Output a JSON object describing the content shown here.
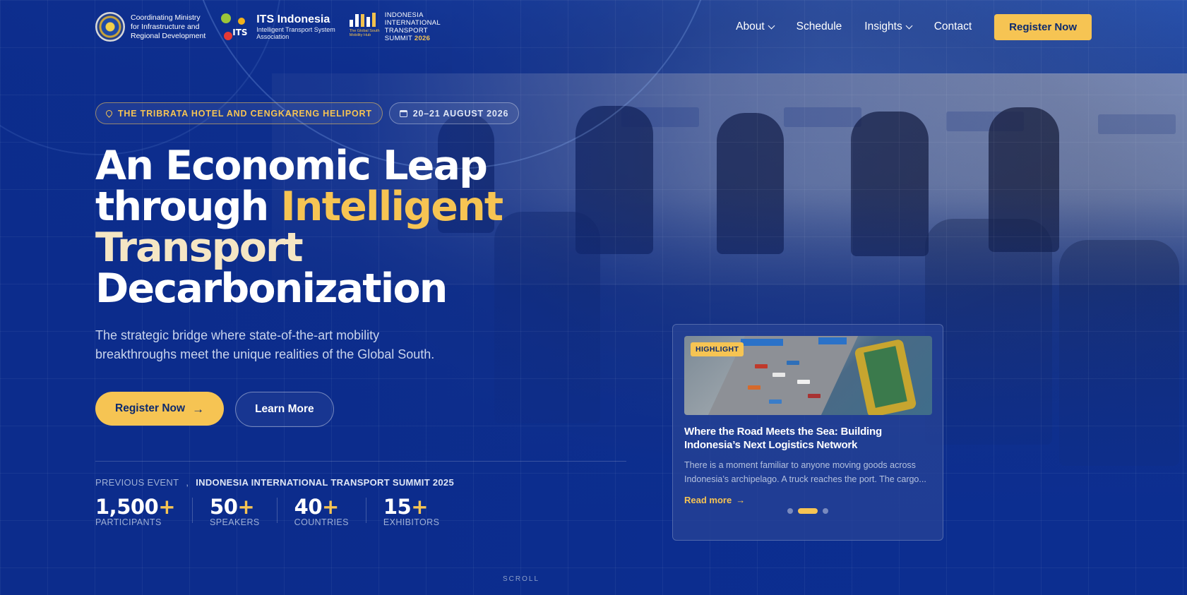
{
  "header": {
    "ministry": [
      "Coordinating Ministry",
      "for Infrastructure and",
      "Regional Development"
    ],
    "its": {
      "name": "ITS Indonesia",
      "subtitle1": "Intelligent Transport System",
      "subtitle2": "Association",
      "mark": "ITS"
    },
    "iits": {
      "lines": [
        "INDONESIA",
        "INTERNATIONAL",
        "TRANSPORT"
      ],
      "summit": "SUMMIT",
      "year": "2026",
      "tagline": "The Global South Mobility Hub"
    },
    "nav": [
      {
        "label": "About",
        "dropdown": true
      },
      {
        "label": "Schedule",
        "dropdown": false
      },
      {
        "label": "Insights",
        "dropdown": true
      },
      {
        "label": "Contact",
        "dropdown": false
      }
    ],
    "register_label": "Register Now"
  },
  "hero": {
    "location": "THE TRIBRATA HOTEL AND CENGKARENG HELIPORT",
    "date": "20–21 AUGUST 2026",
    "title_line1": "An Economic Leap",
    "title_line2_a": "through ",
    "title_line2_b": "Intelligent",
    "title_line3": "Transport",
    "title_line4": "Decarbonization",
    "subtitle": "The strategic bridge where state-of-the-art mobility breakthroughs meet the unique realities of the Global South.",
    "primary_cta": "Register Now",
    "secondary_cta": "Learn More",
    "prev_event_label": "PREVIOUS EVENT",
    "prev_event_sep": ",",
    "prev_event_name": "INDONESIA INTERNATIONAL TRANSPORT SUMMIT 2025",
    "stats": [
      {
        "value": "1,500",
        "plus": "+",
        "label": "PARTICIPANTS"
      },
      {
        "value": "50",
        "plus": "+",
        "label": "SPEAKERS"
      },
      {
        "value": "40",
        "plus": "+",
        "label": "COUNTRIES"
      },
      {
        "value": "15",
        "plus": "+",
        "label": "EXHIBITORS"
      }
    ],
    "scroll": "SCROLL"
  },
  "card": {
    "badge": "HIGHLIGHT",
    "title": "Where the Road Meets the Sea: Building Indonesia’s Next Logistics Network",
    "excerpt": "There is a moment familiar to anyone moving goods across Indonesia’s archipelago. A truck reaches the port. The cargo...",
    "read_more": "Read more",
    "slides": 3,
    "active_slide": 2
  },
  "colors": {
    "accent": "#f6c453",
    "primary": "#0c2a6e",
    "background": "#0d2f8f"
  },
  "icons": {
    "location": "map-pin-icon",
    "date": "calendar-icon",
    "arrow": "arrow-right-icon",
    "dropdown": "chevron-down-icon"
  }
}
